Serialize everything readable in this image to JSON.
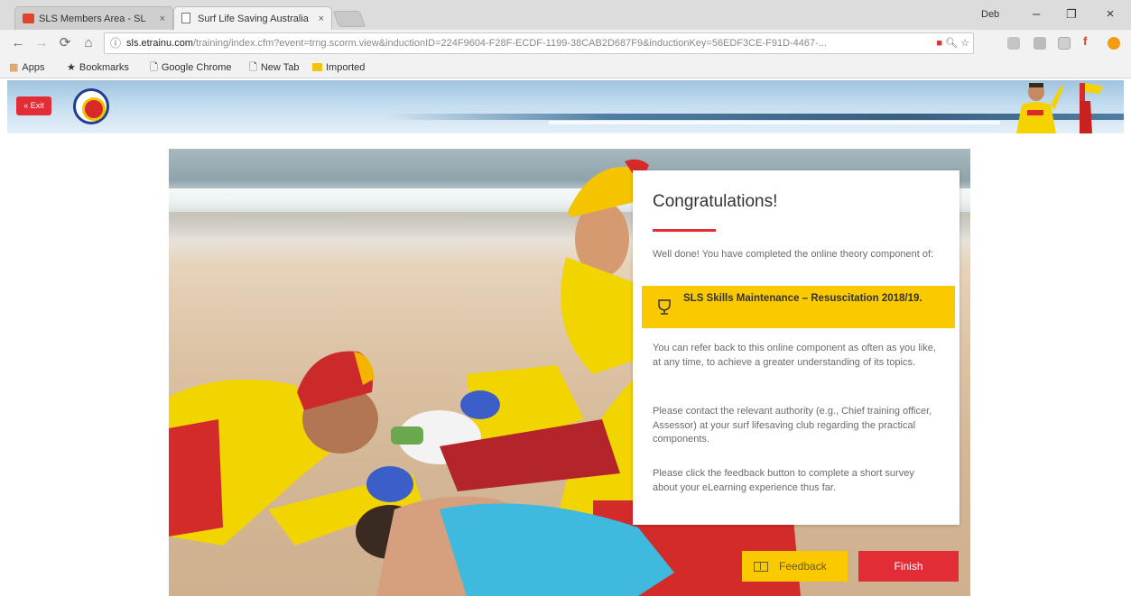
{
  "browser": {
    "tabs": [
      {
        "title": "SLS Members Area - SL",
        "close": "×"
      },
      {
        "title": "Surf Life Saving Australia",
        "close": "×"
      }
    ],
    "user": "Deb",
    "window_controls": [
      "–",
      "❐",
      "×"
    ],
    "nav": {
      "back": "←",
      "forward": "→",
      "reload": "⟳",
      "home": "⌂"
    },
    "url_host": "sls.etrainu.com",
    "url_rest": "/training/index.cfm?event=trng.scorm.view&inductionID=224F9604-F28F-ECDF-1199-38CAB2D687F9&inductionKey=56EDF3CE-F91D-4467-...",
    "bookmarks": [
      {
        "label": "Apps",
        "icon": "apps-grid-icon"
      },
      {
        "label": "Bookmarks",
        "icon": "star-icon"
      },
      {
        "label": "Google Chrome",
        "icon": "page-icon"
      },
      {
        "label": "New Tab",
        "icon": "page-icon"
      },
      {
        "label": "Imported",
        "icon": "folder-icon"
      }
    ]
  },
  "site": {
    "exit_label": "« Exit",
    "brand_color": "#e22d36",
    "accent_color": "#fbc900"
  },
  "card": {
    "title": "Congratulations!",
    "intro": "Well done! You have completed the online theory component of:",
    "course": "SLS Skills Maintenance – Resuscitation 2018/19.",
    "para1": "You can refer back to this online component as often as you like, at any time, to achieve a greater understanding of its topics.",
    "para2": "Please contact the relevant authority (e.g., Chief training officer, Assessor) at your surf lifesaving club regarding the practical components.",
    "para3": "Please click the feedback button to complete a short survey about your eLearning experience thus far."
  },
  "actions": {
    "feedback_label": "Feedback",
    "finish_label": "Finish"
  }
}
